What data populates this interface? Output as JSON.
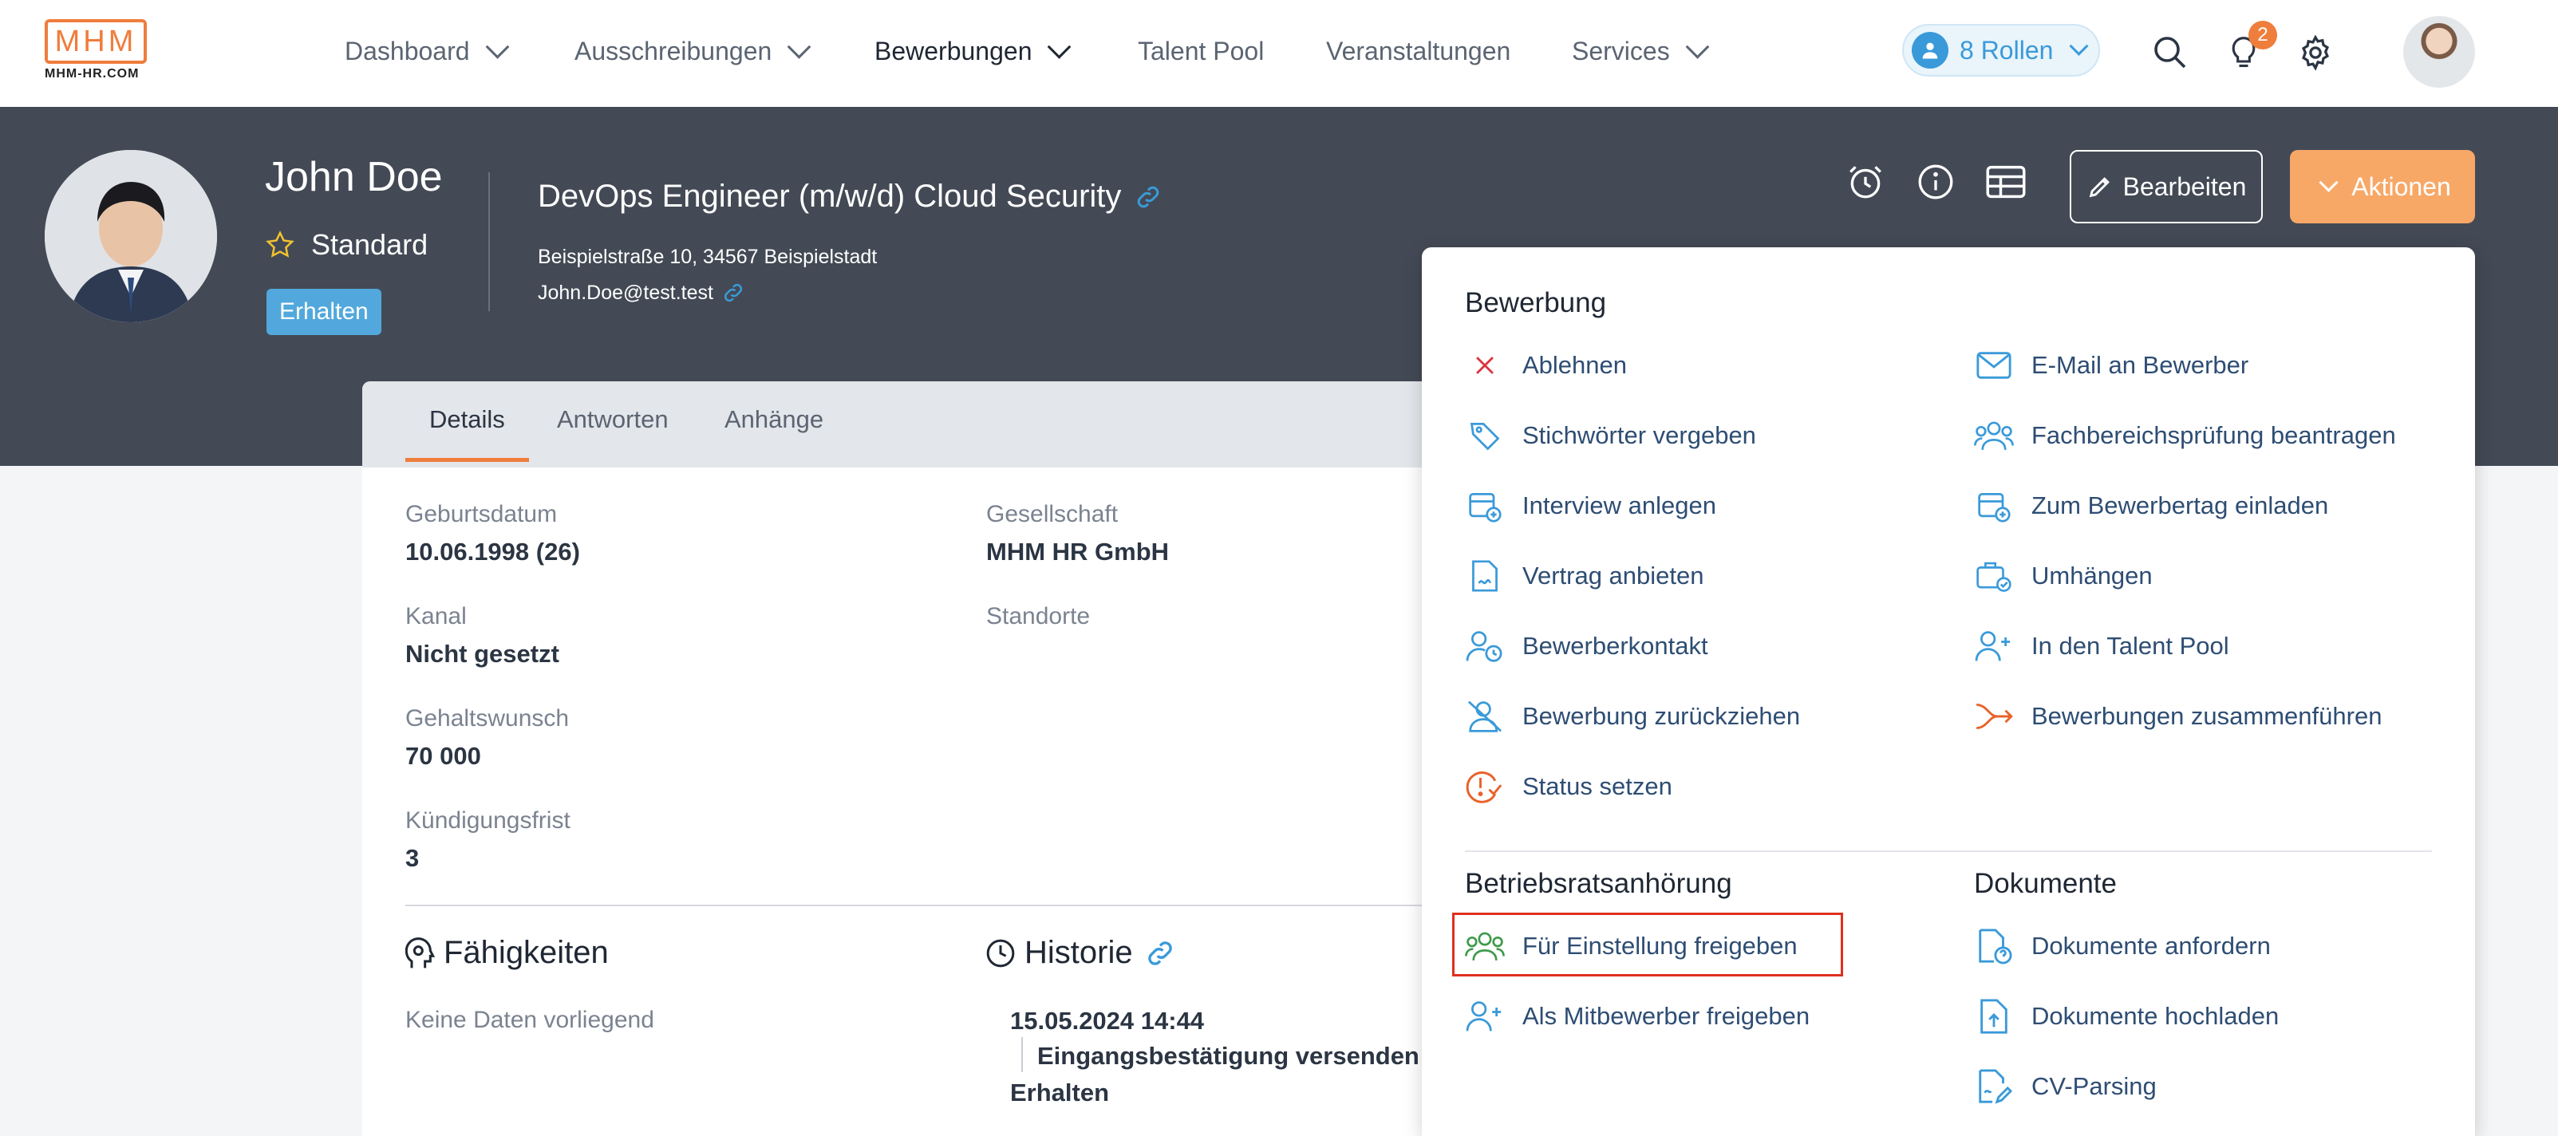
{
  "logo": {
    "text": "MHM",
    "sub": "MHM-HR.COM"
  },
  "nav": {
    "items": [
      {
        "label": "Dashboard"
      },
      {
        "label": "Ausschreibungen"
      },
      {
        "label": "Bewerbungen"
      },
      {
        "label": "Talent Pool"
      },
      {
        "label": "Veranstaltungen"
      },
      {
        "label": "Services"
      }
    ],
    "roles": "8 Rollen",
    "notification_count": "2"
  },
  "candidate": {
    "name": "John Doe",
    "rating": "Standard",
    "status": "Erhalten",
    "job_title": "DevOps Engineer (m/w/d) Cloud Security",
    "address": "Beispielstraße 10, 34567 Beispielstadt",
    "email": "John.Doe@test.test"
  },
  "header_buttons": {
    "edit": "Bearbeiten",
    "actions": "Aktionen"
  },
  "tabs": [
    "Details",
    "Antworten",
    "Anhänge"
  ],
  "details": {
    "birth_label": "Geburtsdatum",
    "birth_value": "10.06.1998 (26)",
    "company_label": "Gesellschaft",
    "company_value": "MHM HR GmbH",
    "channel_label": "Kanal",
    "channel_value": "Nicht gesetzt",
    "locations_label": "Standorte",
    "salary_label": "Gehaltswunsch",
    "salary_value": "70 000",
    "notice_label": "Kündigungsfrist",
    "notice_value": "3"
  },
  "skills": {
    "title": "Fähigkeiten",
    "empty": "Keine Daten vorliegend"
  },
  "history": {
    "title": "Historie",
    "date": "15.05.2024 14:44",
    "event": "Eingangsbestätigung versenden",
    "status": "Erhalten"
  },
  "menu": {
    "section_application": "Bewerbung",
    "left": [
      "Ablehnen",
      "Stichwörter vergeben",
      "Interview anlegen",
      "Vertrag anbieten",
      "Bewerberkontakt",
      "Bewerbung zurückziehen",
      "Status setzen"
    ],
    "right": [
      "E-Mail an Bewerber",
      "Fachbereichsprüfung beantragen",
      "Zum Bewerbertag einladen",
      "Umhängen",
      "In den Talent Pool",
      "Bewerbungen zusammenführen"
    ],
    "section_council": "Betriebsratsanhörung",
    "council": [
      "Für Einstellung freigeben",
      "Als Mitbewerber freigeben"
    ],
    "section_docs": "Dokumente",
    "docs": [
      "Dokumente anfordern",
      "Dokumente hochladen",
      "CV-Parsing"
    ]
  },
  "colors": {
    "accent": "#ef7d3c",
    "link": "#3a9ad9",
    "header_bg": "#434a55",
    "reject": "#d9363e",
    "merge": "#e8632b",
    "council": "#3f9a4a"
  }
}
